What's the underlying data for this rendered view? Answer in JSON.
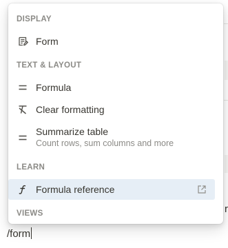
{
  "menu": {
    "sections": [
      {
        "title": "DISPLAY",
        "items": [
          {
            "label": "Form",
            "icon": "form-icon"
          }
        ]
      },
      {
        "title": "TEXT & LAYOUT",
        "items": [
          {
            "label": "Formula",
            "icon": "equals-icon"
          },
          {
            "label": "Clear formatting",
            "icon": "clear-format-icon"
          },
          {
            "label": "Summarize table",
            "sublabel": "Count rows, sum columns and more",
            "icon": "equals-icon"
          }
        ]
      },
      {
        "title": "LEARN",
        "items": [
          {
            "label": "Formula reference",
            "icon": "function-icon",
            "trailing_icon": "external-link-icon",
            "highlighted": true
          }
        ]
      },
      {
        "title": "VIEWS",
        "items": []
      }
    ]
  },
  "editor": {
    "typed_text": "/form"
  },
  "background": {
    "edge_char": "r"
  },
  "colors": {
    "highlight": "#e6eef6",
    "section_text": "#8b8a86",
    "item_text": "#37352f"
  }
}
